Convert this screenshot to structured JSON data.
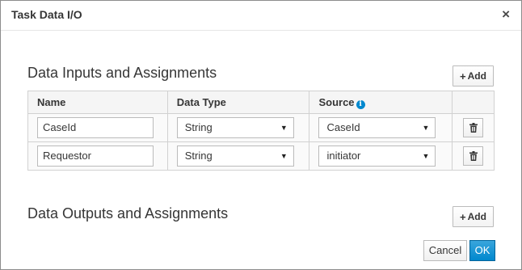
{
  "dialog": {
    "title": "Task Data I/O",
    "close_glyph": "×"
  },
  "inputs_section": {
    "title": "Data Inputs and Assignments",
    "add_label": "Add",
    "columns": {
      "name": "Name",
      "data_type": "Data Type",
      "source": "Source"
    },
    "rows": [
      {
        "name": "CaseId",
        "data_type": "String",
        "source": "CaseId"
      },
      {
        "name": "Requestor",
        "data_type": "String",
        "source": "initiator"
      }
    ]
  },
  "outputs_section": {
    "title": "Data Outputs and Assignments",
    "add_label": "Add"
  },
  "footer": {
    "cancel_label": "Cancel",
    "ok_label": "OK"
  },
  "icons": {
    "info": "info-circle-icon",
    "trash": "trash-icon",
    "plus": "plus-icon",
    "close": "close-icon",
    "caret": "caret-down-icon"
  },
  "colors": {
    "primary": "#0088ce",
    "table_header_bg": "#f5f5f5",
    "border": "#d1d1d1"
  }
}
